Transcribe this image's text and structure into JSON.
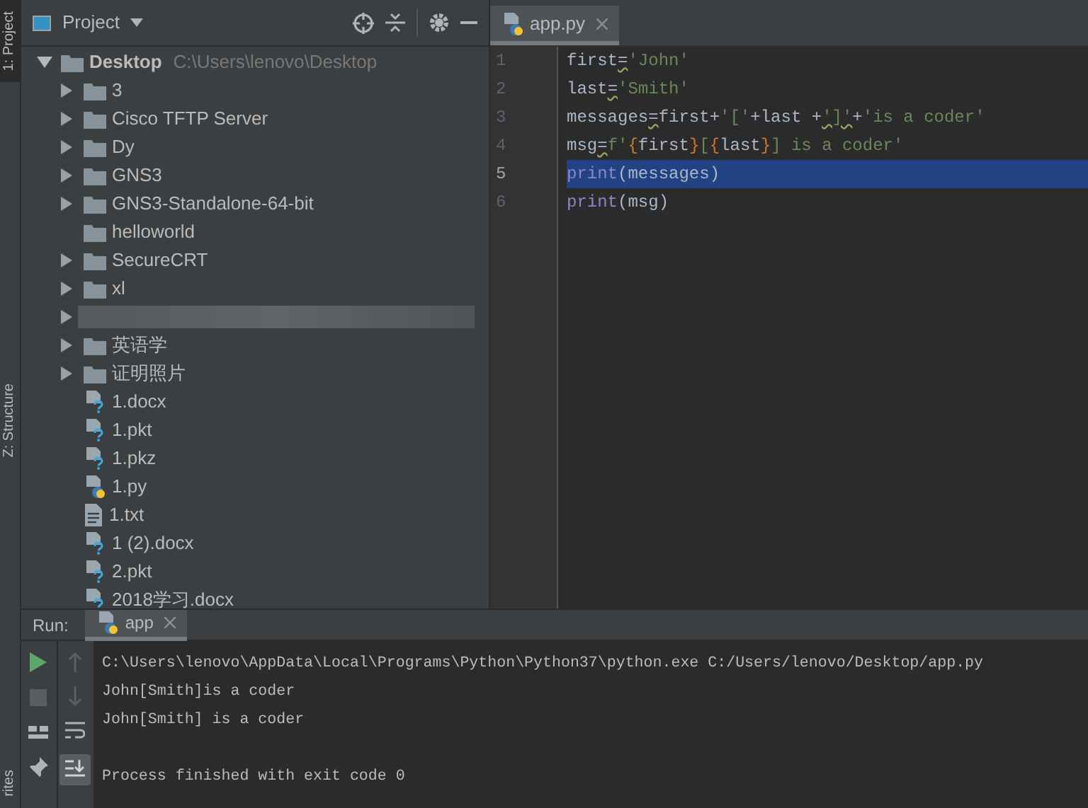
{
  "side_tabs": [
    {
      "label": "1: Project",
      "selected": true
    },
    {
      "label": "Z: Structure",
      "selected": false
    },
    {
      "label": "rites",
      "selected": false
    }
  ],
  "project_panel": {
    "title": "Project",
    "tree": [
      {
        "label": "Desktop",
        "path": "C:\\Users\\lenovo\\Desktop",
        "kind": "folder",
        "expanded": true,
        "children": [
          {
            "label": "3",
            "kind": "folder"
          },
          {
            "label": "Cisco TFTP Server",
            "kind": "folder"
          },
          {
            "label": "Dy",
            "kind": "folder"
          },
          {
            "label": "GNS3",
            "kind": "folder"
          },
          {
            "label": "GNS3-Standalone-64-bit",
            "kind": "folder"
          },
          {
            "label": "helloworld",
            "kind": "empty_folder"
          },
          {
            "label": "SecureCRT",
            "kind": "folder"
          },
          {
            "label": "xl",
            "kind": "folder"
          },
          {
            "kind": "redacted"
          },
          {
            "label": "英语学",
            "kind": "folder"
          },
          {
            "label": "证明照片",
            "kind": "folder"
          },
          {
            "label": "1.docx",
            "kind": "unknown_file"
          },
          {
            "label": "1.pkt",
            "kind": "unknown_file"
          },
          {
            "label": "1.pkz",
            "kind": "unknown_file"
          },
          {
            "label": "1.py",
            "kind": "python_file"
          },
          {
            "label": "1.txt",
            "kind": "text_file"
          },
          {
            "label": "1 (2).docx",
            "kind": "unknown_file"
          },
          {
            "label": "2.pkt",
            "kind": "unknown_file"
          },
          {
            "label": "2018学习.docx",
            "kind": "unknown_file"
          }
        ]
      }
    ]
  },
  "editor": {
    "tabs": [
      {
        "label": "app.py",
        "selected": true
      }
    ],
    "lines": [
      {
        "number": "1",
        "selected": false,
        "tokens": [
          {
            "text": "first",
            "kind": "plain"
          },
          {
            "text": "=",
            "kind": "warn"
          },
          {
            "text": "'John'",
            "kind": "string"
          }
        ]
      },
      {
        "number": "2",
        "selected": false,
        "tokens": [
          {
            "text": "last",
            "kind": "plain"
          },
          {
            "text": "=",
            "kind": "warn"
          },
          {
            "text": "'Smith'",
            "kind": "string"
          }
        ]
      },
      {
        "number": "3",
        "selected": false,
        "tokens": [
          {
            "text": "messages",
            "kind": "plain"
          },
          {
            "text": "=",
            "kind": "warn"
          },
          {
            "text": "first+",
            "kind": "plain"
          },
          {
            "text": "'['",
            "kind": "string"
          },
          {
            "text": "+last +",
            "kind": "plain"
          },
          {
            "text": "']'",
            "kind": "warn_string"
          },
          {
            "text": "+",
            "kind": "plain"
          },
          {
            "text": "'is a coder'",
            "kind": "string"
          }
        ]
      },
      {
        "number": "4",
        "selected": false,
        "tokens": [
          {
            "text": "msg",
            "kind": "plain"
          },
          {
            "text": "=",
            "kind": "warn"
          },
          {
            "text": "f'",
            "kind": "string"
          },
          {
            "text": "{",
            "kind": "brace"
          },
          {
            "text": "first",
            "kind": "plain"
          },
          {
            "text": "}",
            "kind": "brace"
          },
          {
            "text": "[",
            "kind": "string"
          },
          {
            "text": "{",
            "kind": "brace"
          },
          {
            "text": "last",
            "kind": "plain"
          },
          {
            "text": "}",
            "kind": "brace"
          },
          {
            "text": "] is a coder'",
            "kind": "string"
          }
        ]
      },
      {
        "number": "5",
        "selected": true,
        "tokens": [
          {
            "text": "print",
            "kind": "builtin"
          },
          {
            "text": "(messages)",
            "kind": "plain"
          }
        ]
      },
      {
        "number": "6",
        "selected": false,
        "tokens": [
          {
            "text": "print",
            "kind": "builtin"
          },
          {
            "text": "(msg)",
            "kind": "plain"
          }
        ]
      }
    ]
  },
  "run_panel": {
    "label": "Run:",
    "tabs": [
      {
        "label": "app",
        "selected": true
      }
    ],
    "console": [
      {
        "text": "C:\\Users\\lenovo\\AppData\\Local\\Programs\\Python\\Python37\\python.exe C:/Users/lenovo/Desktop/app.py",
        "kind": "command"
      },
      {
        "text": "John[Smith]is a coder",
        "kind": "output"
      },
      {
        "text": "John[Smith] is a coder",
        "kind": "output"
      },
      {
        "text": "Process finished with exit code 0",
        "kind": "exit"
      }
    ]
  }
}
